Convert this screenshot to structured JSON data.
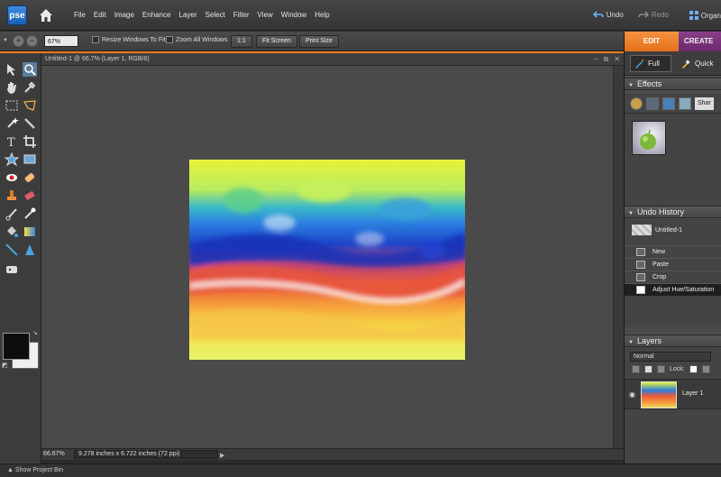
{
  "app": {
    "logo_text": "pse",
    "menu": [
      "File",
      "Edit",
      "Image",
      "Enhance",
      "Layer",
      "Select",
      "Filter",
      "View",
      "Window",
      "Help"
    ],
    "undo_label": "Undo",
    "redo_label": "Redo",
    "organizer_label": "Organ"
  },
  "options_bar": {
    "zoom_value": "67%",
    "resize_windows_label": "Resize Windows To Fit",
    "zoom_all_windows_label": "Zoom All Windows",
    "actual_pixels_label": "1:1",
    "fit_screen_label": "Fit Screen",
    "print_size_label": "Print Size"
  },
  "document": {
    "title": "Untitled-1 @ 66.7% (Layer 1, RGB/8)",
    "status_zoom": "66.67%",
    "status_info": "9.278 inches x 6.722 inches (72 ppi)"
  },
  "bottom_bar": {
    "show_project_bin": "Show Project Bin"
  },
  "panel": {
    "tab_edit": "EDIT",
    "tab_create": "CREATE",
    "mode_full": "Full",
    "mode_quick": "Quick",
    "effects_title": "Effects",
    "effects_dropdown": "Shar",
    "undo_history_title": "Undo History",
    "history": [
      "Untitled-1",
      "New",
      "Paste",
      "Crop",
      "Adjust Hue/Saturation"
    ],
    "layers_title": "Layers",
    "blend_mode": "Normal",
    "lock_label": "Lock:",
    "layer_name": "Layer 1"
  },
  "colors": {
    "accent_orange": "#f07c1c",
    "create_purple": "#7a347a",
    "foreground_swatch": "#0d0d0d",
    "background_swatch": "#f0f0f0"
  }
}
